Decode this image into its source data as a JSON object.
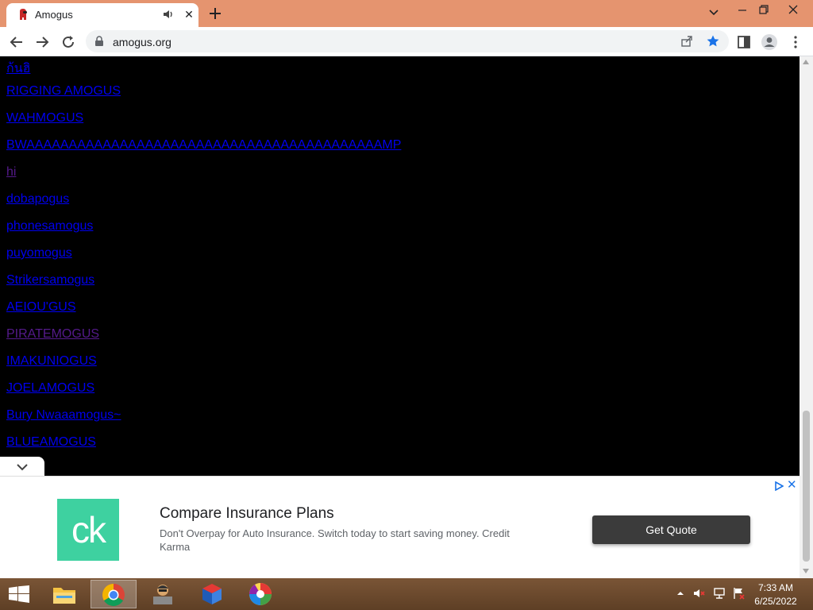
{
  "browser": {
    "tab_title": "Amogus",
    "url": "amogus.org"
  },
  "page": {
    "links": [
      {
        "text": "ก้นฮิ",
        "visited": false
      },
      {
        "text": "RIGGING AMOGUS",
        "visited": false
      },
      {
        "text": "WAHMOGUS",
        "visited": false
      },
      {
        "text": "BWAAAAAAAAAAAAAAAAAAAAAAAAAAAAAAAAAAAAAAAAAAMP",
        "visited": false
      },
      {
        "text": "hi",
        "visited": true
      },
      {
        "text": "dobapogus",
        "visited": false
      },
      {
        "text": "phonesamogus",
        "visited": false
      },
      {
        "text": "puyomogus",
        "visited": false
      },
      {
        "text": "Strikersamogus",
        "visited": false
      },
      {
        "text": "AEIOU'GUS",
        "visited": false
      },
      {
        "text": "PIRATEMOGUS",
        "visited": true
      },
      {
        "text": "IMAKUNIOGUS",
        "visited": false
      },
      {
        "text": "JOELAMOGUS",
        "visited": false
      },
      {
        "text": "Bury Nwaaamogus~",
        "visited": false
      },
      {
        "text": "BLUEAMOGUS",
        "visited": false
      }
    ]
  },
  "ad": {
    "logo_text": "ck",
    "title": "Compare Insurance Plans",
    "description": "Don't Overpay for Auto Insurance. Switch today to start saving money. Credit Karma",
    "cta": "Get Quote",
    "close": "✕"
  },
  "taskbar": {
    "time": "7:33 AM",
    "date": "6/25/2022"
  },
  "colors": {
    "tabstrip": "#e5946f",
    "link": "#0000ee",
    "visited_link": "#551a8b",
    "ad_logo": "#3ed1a0"
  }
}
